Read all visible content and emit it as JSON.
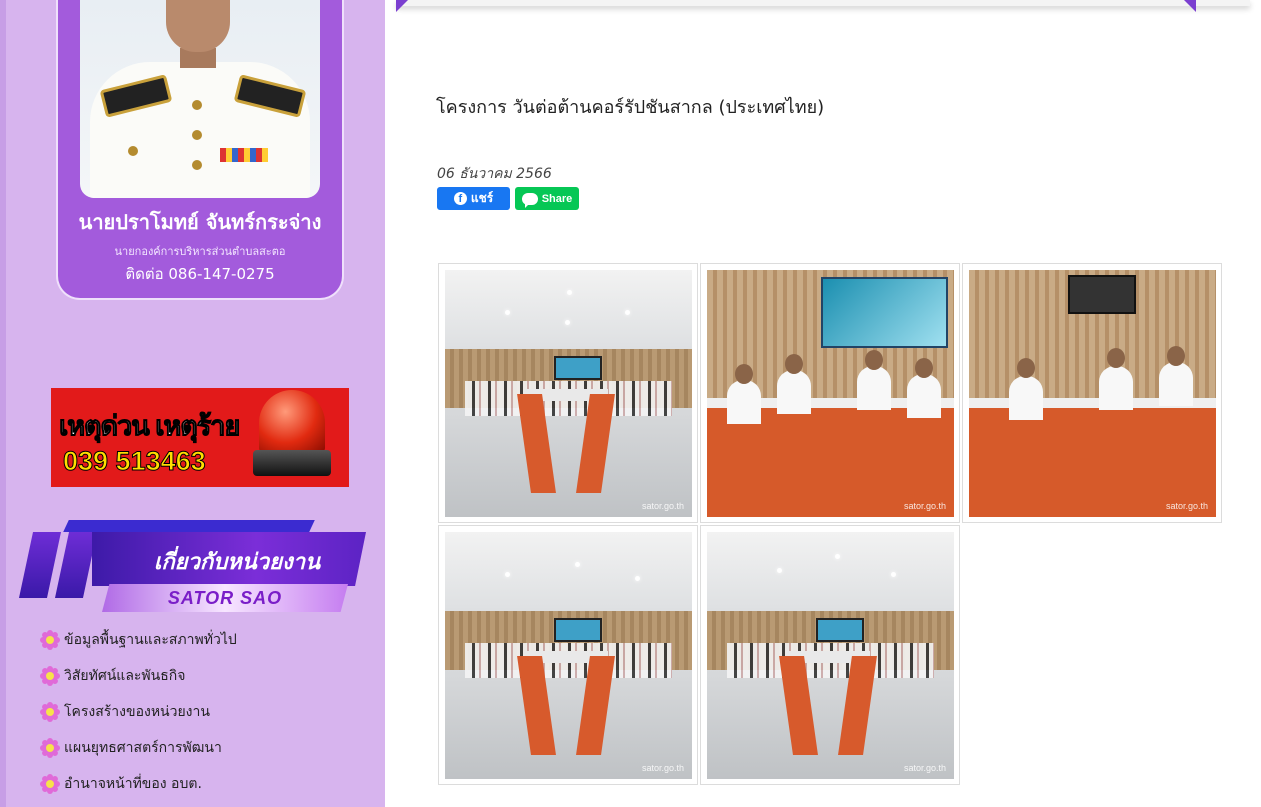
{
  "profile": {
    "name": "นายปราโมทย์ จันทร์กระจ่าง",
    "role": "นายกองค์การบริหารส่วนตำบลสะตอ",
    "phone": "ติดต่อ 086-147-0275"
  },
  "emergency": {
    "title": "เหตุด่วน เหตุร้าย",
    "phone": "039 513463"
  },
  "about": {
    "title": "เกี่ยวกับหน่วยงาน",
    "subtitle": "SATOR SAO"
  },
  "menu": {
    "items": [
      {
        "label": "ข้อมูลพื้นฐานและสภาพทั่วไป"
      },
      {
        "label": "วิสัยทัศน์และพันธกิจ"
      },
      {
        "label": "โครงสร้างของหน่วยงาน"
      },
      {
        "label": "แผนยุทธศาสตร์การพัฒนา"
      },
      {
        "label": "อำนาจหน้าที่ของ อบต."
      }
    ]
  },
  "article": {
    "title": "โครงการ วันต่อต้านคอร์รัปชันสากล (ประเทศไทย)",
    "date": "06 ธันวาคม 2566"
  },
  "share": {
    "facebook_label": "แชร์",
    "line_label": "Share"
  },
  "gallery": {
    "watermark": "sator.go.th",
    "count": 5
  },
  "colors": {
    "sidebar": "#d7b4ee",
    "profile_card": "#a35bdc",
    "facebook": "#1877f2",
    "line": "#06c755",
    "emergency": "#e21a1a"
  }
}
